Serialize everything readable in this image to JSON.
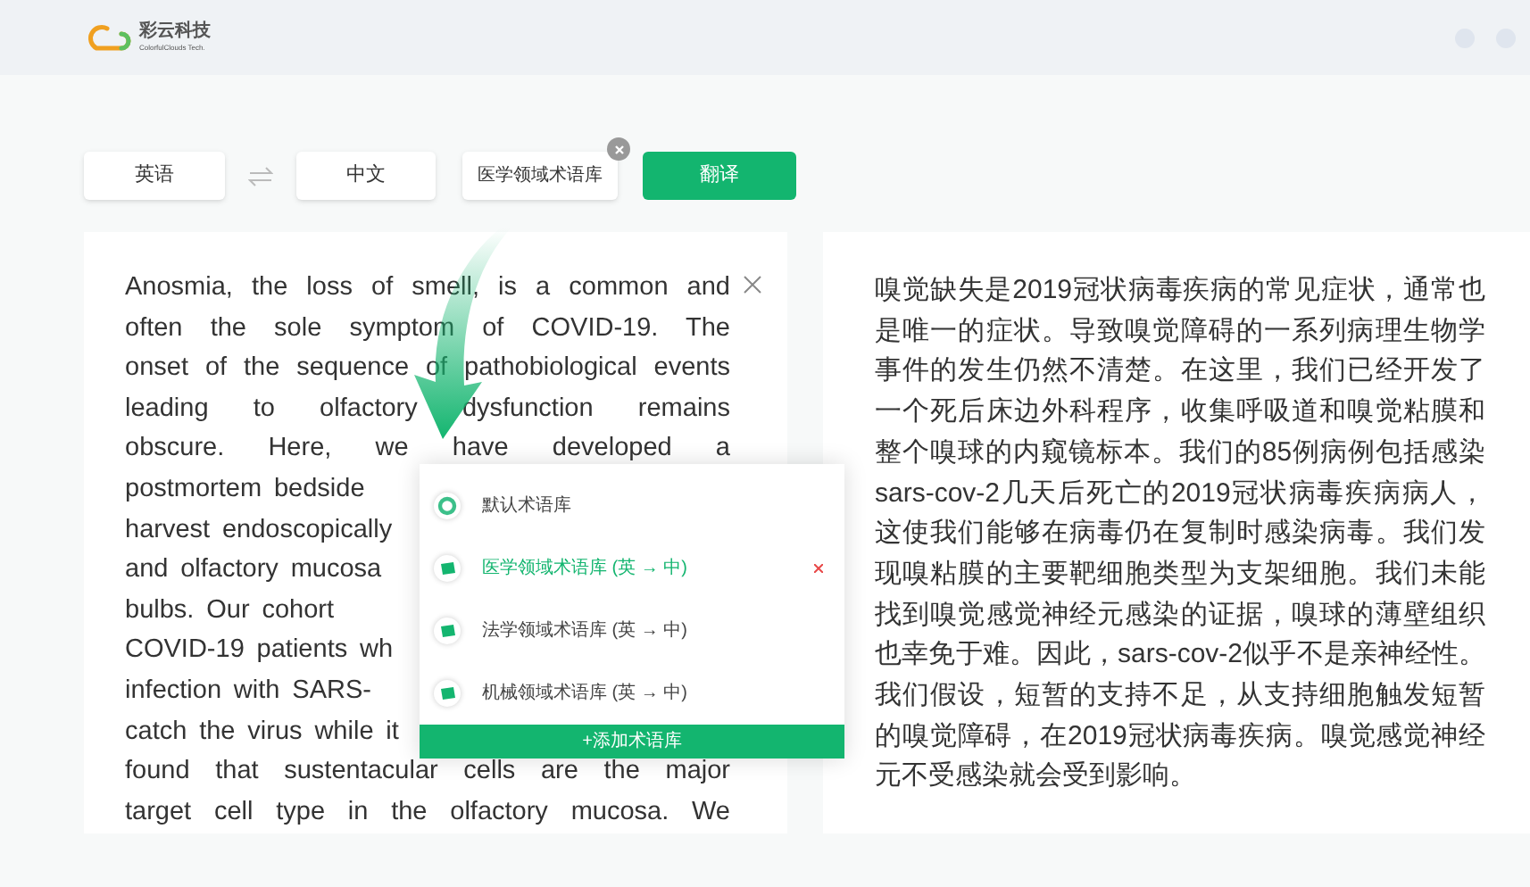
{
  "header": {
    "brand": "彩云科技",
    "brand_subtitle": "ColorfulClouds Tech."
  },
  "toolbar": {
    "source_language": "英语",
    "target_language": "中文",
    "glossary": "医学领域术语库",
    "translate_button": "翻译"
  },
  "source_text": {
    "lines": [
      {
        "text": "Anosmia, the loss of smell, is a common and",
        "kind": "full"
      },
      {
        "text": "often the sole symptom of COVID-19. The",
        "kind": "full"
      },
      {
        "text": "onset of the sequence of pathobiological events",
        "kind": "full"
      },
      {
        "text": "leading to olfactory dysfunction remains",
        "kind": "full"
      },
      {
        "text": "obscure. Here, we have developed a",
        "kind": "full"
      },
      {
        "text": "postmortem bedside",
        "kind": "cut"
      },
      {
        "text": "harvest endoscopically",
        "kind": "cut"
      },
      {
        "text": "and olfactory mucosa",
        "kind": "cut"
      },
      {
        "text": "bulbs. Our cohort",
        "kind": "cut"
      },
      {
        "text": "COVID-19 patients wh",
        "kind": "cut"
      },
      {
        "text": "infection with SARS-",
        "kind": "cut"
      },
      {
        "text": "catch the virus while it",
        "kind": "cut"
      },
      {
        "text": "found that sustentacular cells are the major",
        "kind": "full"
      },
      {
        "text": "target cell type in the olfactory mucosa. We",
        "kind": "full"
      }
    ]
  },
  "glossary_menu": {
    "items": [
      {
        "label": "默认术语库",
        "kind": "default",
        "selected": false
      },
      {
        "label": "医学领域术语库 (英 → 中)",
        "kind": "domain",
        "selected": true
      },
      {
        "label": "法学领域术语库 (英 → 中)",
        "kind": "domain",
        "selected": false
      },
      {
        "label": "机械领域术语库 (英 → 中)",
        "kind": "domain",
        "selected": false
      }
    ],
    "add_button": "+添加术语库"
  },
  "translation": "嗅觉缺失是2019冠状病毒疾病的常见症状，通常也是唯一的症状。导致嗅觉障碍的一系列病理生物学事件的发生仍然不清楚。在这里，我们已经开发了一个死后床边外科程序，收集呼吸道和嗅觉粘膜和整个嗅球的内窥镜标本。我们的85例病例包括感染sars-cov-2几天后死亡的2019冠状病毒疾病病人，这使我们能够在病毒仍在复制时感染病毒。我们发现嗅粘膜的主要靶细胞类型为支架细胞。我们未能找到嗅觉感觉神经元感染的证据，嗅球的薄壁组织也幸免于难。因此，sars-cov-2似乎不是亲神经性。我们假设，短暂的支持不足，从支持细胞触发短暂的嗅觉障碍，在2019冠状病毒疾病。嗅觉感觉神经元不受感染就会受到影响。"
}
